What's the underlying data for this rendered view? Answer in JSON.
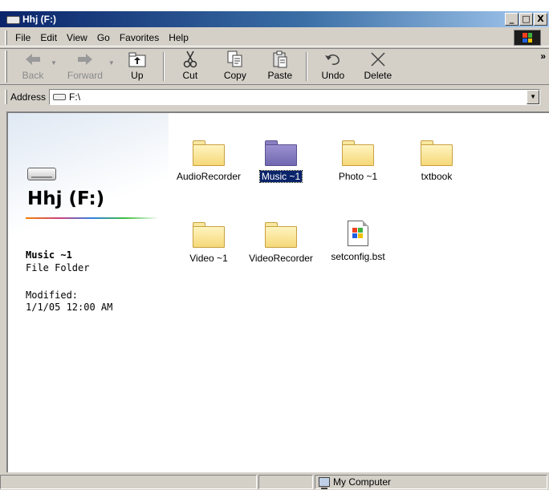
{
  "window": {
    "title": "Hhj (F:)",
    "buttons": {
      "minimize": "_",
      "maximize": "□",
      "close": "X"
    }
  },
  "menu": [
    "File",
    "Edit",
    "View",
    "Go",
    "Favorites",
    "Help"
  ],
  "toolbar": {
    "back": "Back",
    "forward": "Forward",
    "up": "Up",
    "cut": "Cut",
    "copy": "Copy",
    "paste": "Paste",
    "undo": "Undo",
    "delete": "Delete",
    "more": "»"
  },
  "address": {
    "label": "Address",
    "value": "F:\\"
  },
  "info_pane": {
    "drive_title": "Hhj (F:)",
    "selected_name": "Music ~1",
    "selected_type": "File Folder",
    "modified_label": "Modified:",
    "modified_date": "1/1/05 12:00 AM"
  },
  "items": [
    {
      "label": "AudioRecorder",
      "icon": "folder-icon",
      "selected": false
    },
    {
      "label": "Music ~1",
      "icon": "folder-icon",
      "selected": true
    },
    {
      "label": "Photo ~1",
      "icon": "folder-icon",
      "selected": false
    },
    {
      "label": "txtbook",
      "icon": "folder-icon",
      "selected": false
    },
    {
      "label": "Video ~1",
      "icon": "folder-icon",
      "selected": false
    },
    {
      "label": "VideoRecorder",
      "icon": "folder-icon",
      "selected": false
    },
    {
      "label": "setconfig.bst",
      "icon": "file-icon",
      "selected": false
    }
  ],
  "statusbar": {
    "location": "My Computer"
  },
  "colors": {
    "titlebar_start": "#0a246a",
    "titlebar_end": "#a6caf0",
    "selection": "#0a246a",
    "chrome": "#d4d0c8"
  }
}
